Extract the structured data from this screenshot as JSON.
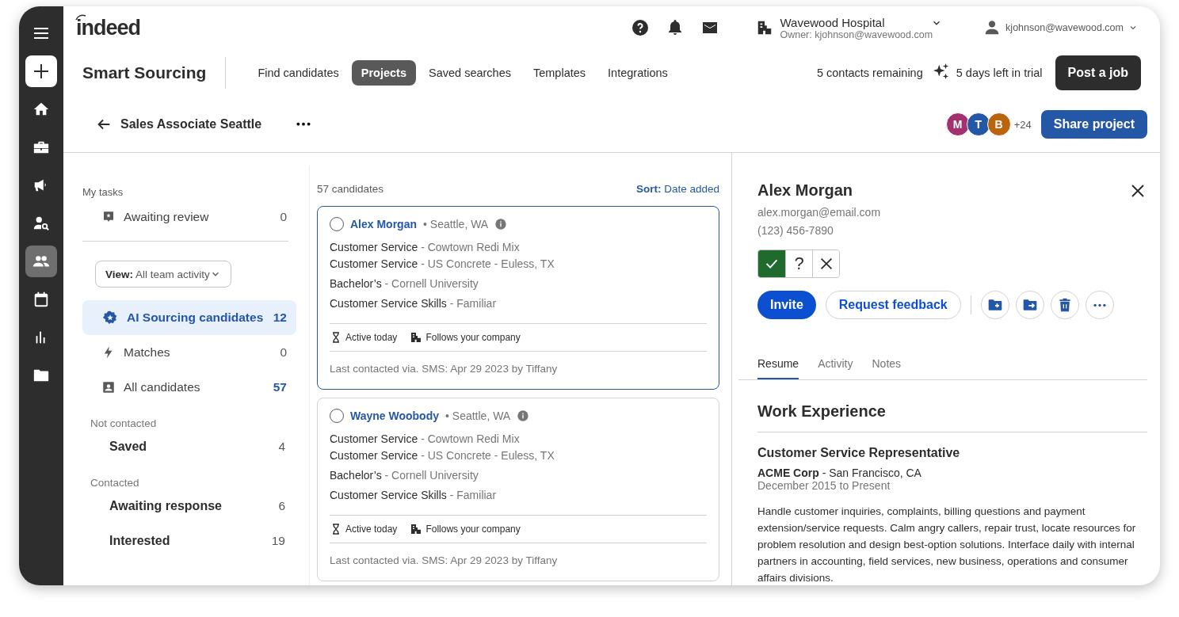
{
  "rail": {
    "items": [
      {
        "selected": false
      },
      {
        "selected": false
      },
      {
        "selected": false
      },
      {
        "selected": false
      },
      {
        "selected": true
      },
      {
        "selected": false
      },
      {
        "selected": false
      },
      {
        "selected": false
      }
    ]
  },
  "header": {
    "logo": "indeed",
    "org_name": "Wavewood Hospital",
    "org_owner": "Owner: kjohnson@wavewood.com",
    "user": "kjohnson@wavewood.com"
  },
  "product": "Smart Sourcing",
  "nav": [
    {
      "label": "Find candidates",
      "selected": false
    },
    {
      "label": "Projects",
      "selected": true
    },
    {
      "label": "Saved searches",
      "selected": false
    },
    {
      "label": "Templates",
      "selected": false
    },
    {
      "label": "Integrations",
      "selected": false
    }
  ],
  "contacts_remaining": "5 contacts remaining",
  "trial": "5 days left in trial",
  "post_button": "Post a job",
  "project": {
    "title": "Sales Associate Seattle",
    "members": [
      {
        "initial": "M",
        "color": "#a3316f"
      },
      {
        "initial": "T",
        "color": "#2557a7"
      },
      {
        "initial": "B",
        "color": "#b8650d"
      }
    ],
    "more_members": "+24",
    "share_button": "Share project"
  },
  "tasks": {
    "heading": "My tasks",
    "review": {
      "label": "Awaiting review",
      "count": "0"
    },
    "view": "**View:** All team activity",
    "items": [
      {
        "label": "AI Sourcing candidates",
        "count": "12",
        "selected": true,
        "highlighted": false
      },
      {
        "label": "Matches",
        "count": "0",
        "selected": false,
        "highlighted": false
      },
      {
        "label": "All candidates",
        "count": "57",
        "selected": false,
        "highlighted": true
      }
    ],
    "groups": [
      {
        "heading": "Not contacted",
        "items": [
          {
            "label": "Saved",
            "count": "4"
          }
        ]
      },
      {
        "heading": "Contacted",
        "items": [
          {
            "label": "Awaiting response",
            "count": "6"
          },
          {
            "label": "Interested",
            "count": "19"
          }
        ]
      }
    ]
  },
  "candidates": {
    "count": "57 candidates",
    "sort": "**Sort:** Date added",
    "cards": [
      {
        "selected": true,
        "checked": false,
        "name": "Alex Morgan",
        "location": "• Seattle, WA",
        "lines": [
          {
            "title": "Customer Service",
            "detail": "- Cowtown Redi Mix"
          },
          {
            "title": "Customer Service",
            "detail": "- US Concrete - Euless, TX"
          },
          {
            "title": "Bachelor’s",
            "detail": "- Cornell University"
          },
          {
            "title": "Customer Service Skills",
            "detail": "- Familiar"
          }
        ],
        "tags": [
          "Active today",
          "Follows your company"
        ],
        "last_contacted": "Last contacted via. SMS: Apr 29 2023 by Tiffany"
      },
      {
        "selected": false,
        "checked": false,
        "name": "Wayne Woobody",
        "location": "• Seattle, WA",
        "lines": [
          {
            "title": "Customer Service",
            "detail": "- Cowtown Redi Mix"
          },
          {
            "title": "Customer Service",
            "detail": "- US Concrete - Euless, TX"
          },
          {
            "title": "Bachelor’s",
            "detail": "- Cornell University"
          },
          {
            "title": "Customer Service Skills",
            "detail": "- Familiar"
          }
        ],
        "tags": [
          "Active today",
          "Follows your company"
        ],
        "last_contacted": "Last contacted via. SMS: Apr 29 2023 by Tiffany"
      }
    ]
  },
  "detail": {
    "name": "Alex Morgan",
    "email": "alex.morgan@email.com",
    "phone": "(123) 456-7890",
    "rating": [
      {
        "kind": "yes",
        "selected": true
      },
      {
        "kind": "maybe",
        "label": "?",
        "selected": false
      },
      {
        "kind": "no",
        "selected": false
      }
    ],
    "invite_button": "Invite",
    "feedback_button": "Request feedback",
    "tabs": [
      {
        "label": "Resume",
        "selected": true
      },
      {
        "label": "Activity",
        "selected": false
      },
      {
        "label": "Notes",
        "selected": false
      }
    ],
    "section": "Work Experience",
    "job_title": "Customer Service Representative",
    "company": "**ACME Corp** - San Francisco, CA",
    "dates": "December 2015 to Present",
    "description": "Handle customer inquiries, complaints, billing questions and payment extension/service requests. Calm angry callers, repair trust, locate resources for problem resolution and design best-option solutions. Interface daily with internal partners in accounting, field services, new business, operations and consumer affairs divisions."
  }
}
